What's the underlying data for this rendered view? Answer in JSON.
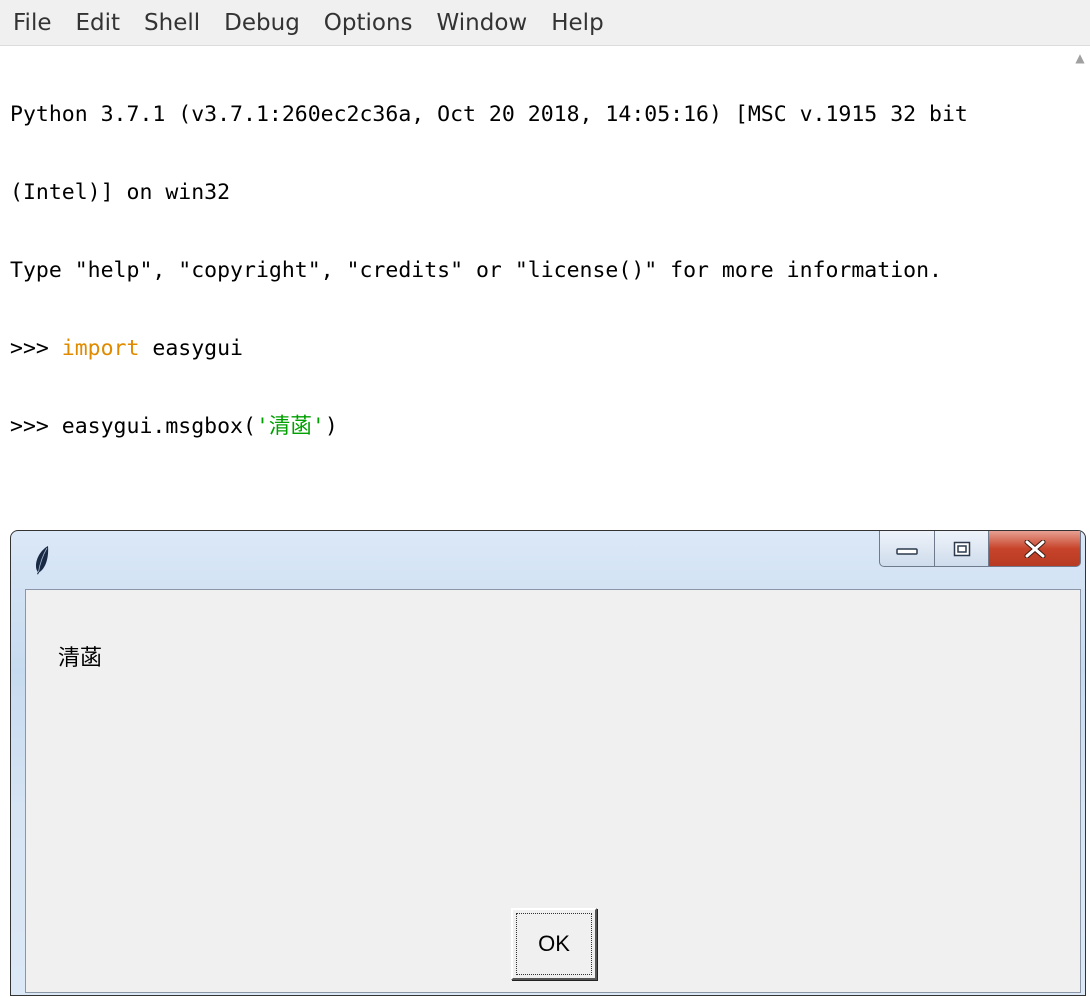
{
  "menubar": {
    "items": [
      "File",
      "Edit",
      "Shell",
      "Debug",
      "Options",
      "Window",
      "Help"
    ]
  },
  "shell": {
    "banner_line1": "Python 3.7.1 (v3.7.1:260ec2c36a, Oct 20 2018, 14:05:16) [MSC v.1915 32 bit",
    "banner_line2": "(Intel)] on win32",
    "banner_line3": "Type \"help\", \"copyright\", \"credits\" or \"license()\" for more information.",
    "prompt": ">>> ",
    "line4_keyword": "import",
    "line4_rest": " easygui",
    "line5_call_prefix": "easygui.msgbox(",
    "line5_string": "'清菡'",
    "line5_suffix": ")"
  },
  "dialog": {
    "icon": "feather-icon",
    "message": "清菡",
    "ok_label": "OK",
    "window_buttons": [
      "minimize-icon",
      "maximize-icon",
      "close-icon"
    ]
  },
  "colors": {
    "keyword": "#e08a00",
    "string": "#00a000",
    "close_button": "#c7442b",
    "titlebar": "#c7dbf0"
  }
}
